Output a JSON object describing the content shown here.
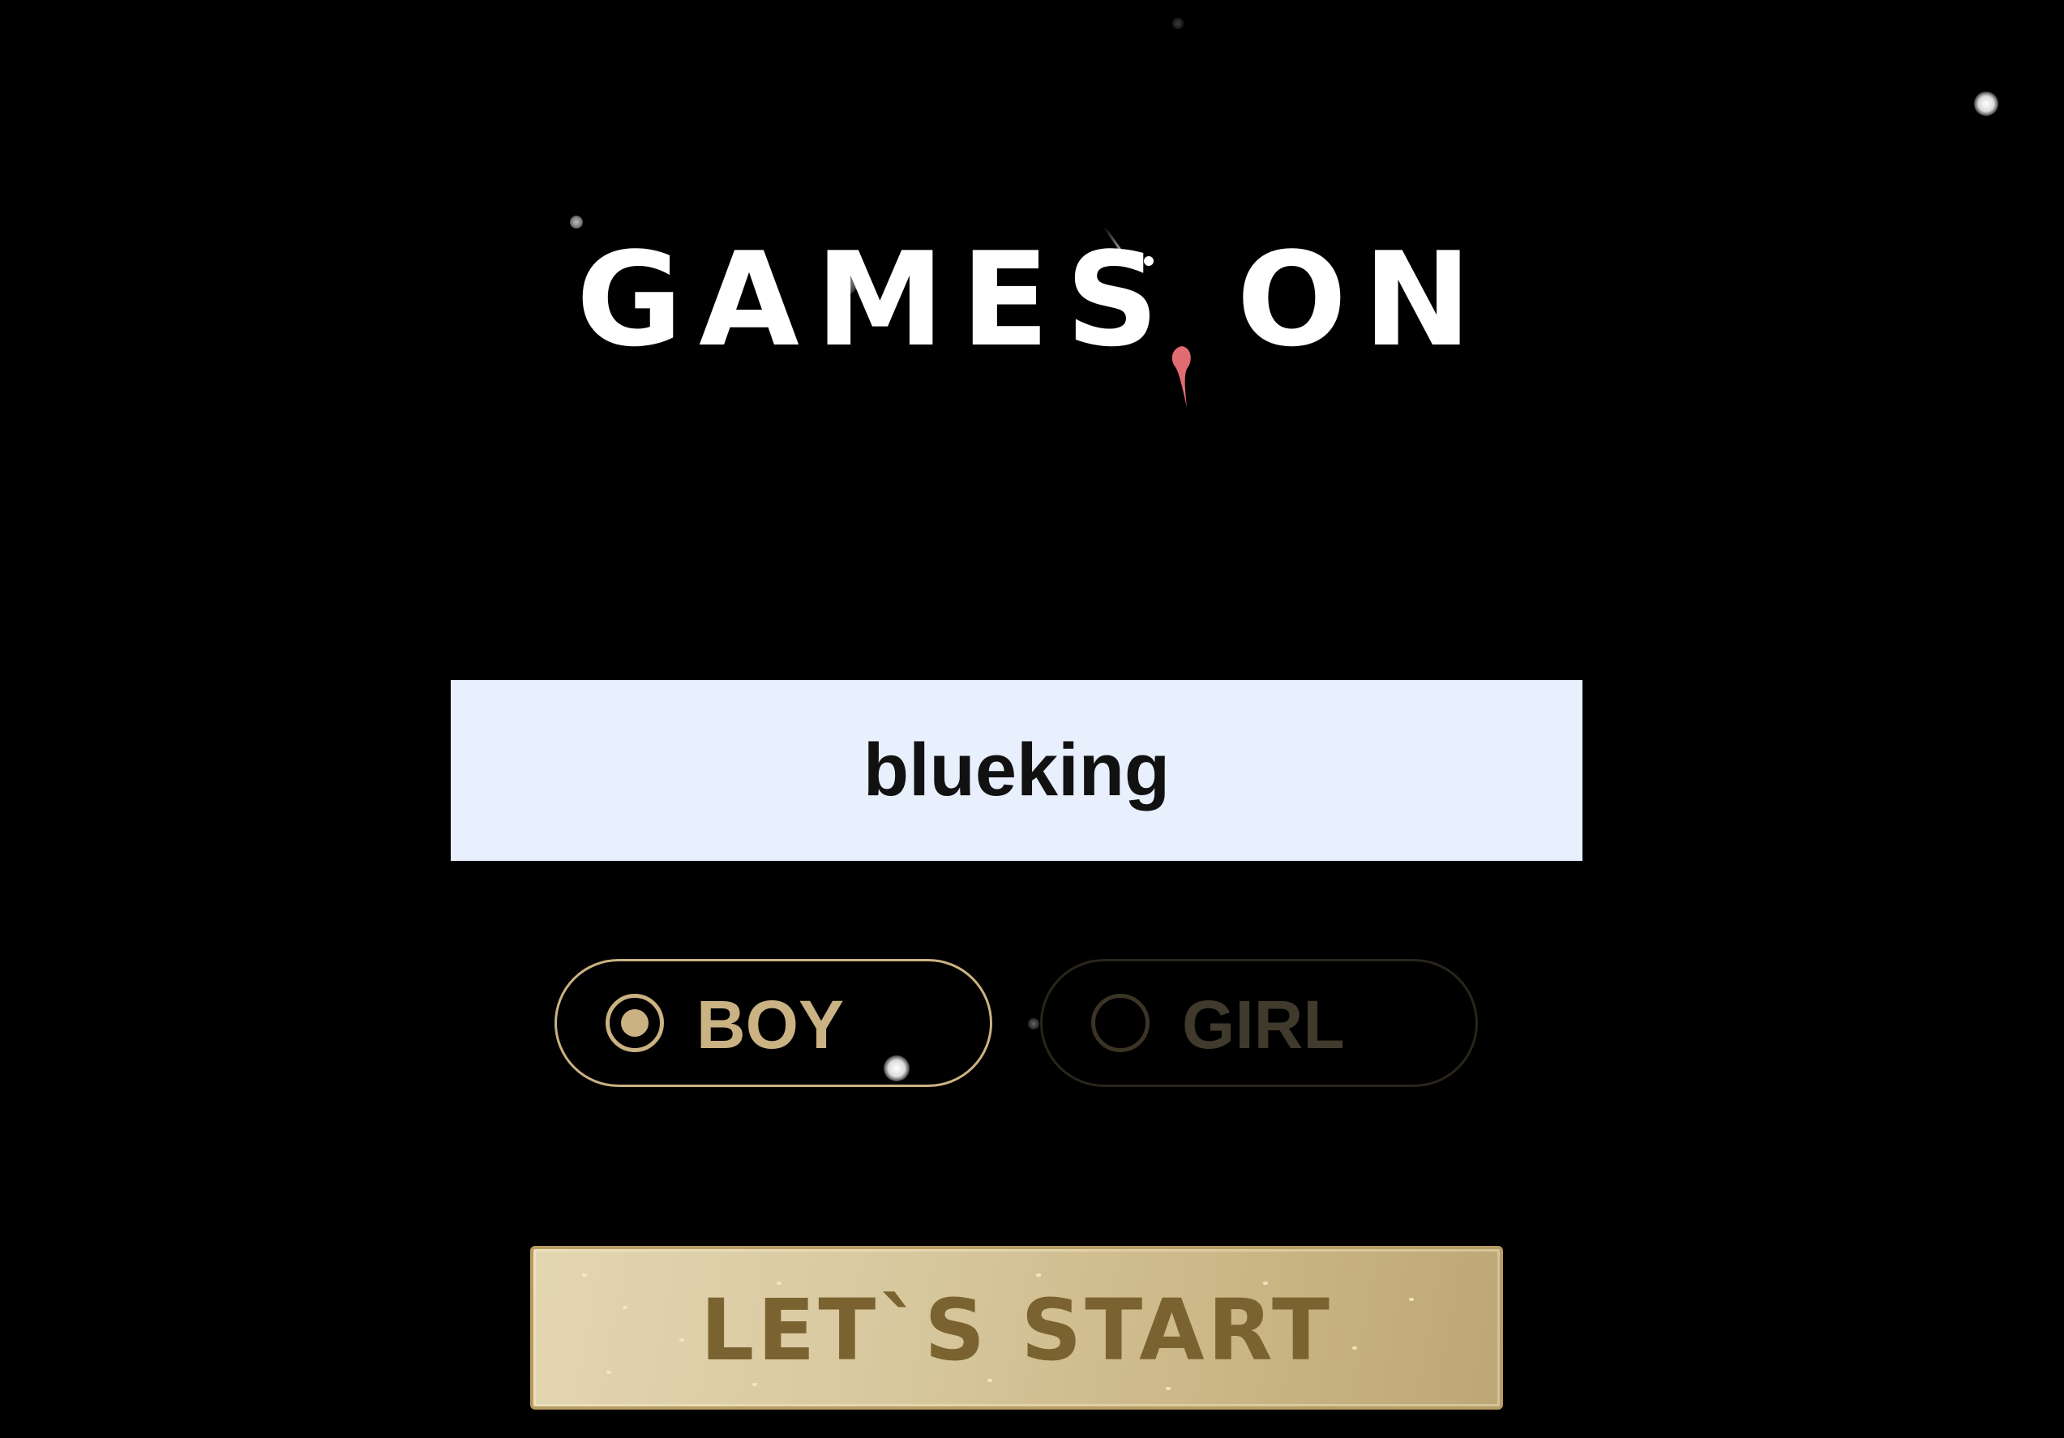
{
  "title": "GAMES ON",
  "name_input": {
    "value": "blueking",
    "placeholder": ""
  },
  "gender": {
    "selected": "BOY",
    "options": [
      {
        "label": "BOY",
        "selected": true
      },
      {
        "label": "GIRL",
        "selected": false
      }
    ]
  },
  "start_button": {
    "label": "LET`S START"
  },
  "icons": {
    "selected_radio": "radio-selected-icon",
    "unselected_radio": "radio-unselected-icon"
  },
  "colors": {
    "background": "#000000",
    "accent_gold": "#cbb283",
    "input_background": "#e8effd",
    "button_text": "#7a6330",
    "inactive_option": "#3f3a2c"
  }
}
